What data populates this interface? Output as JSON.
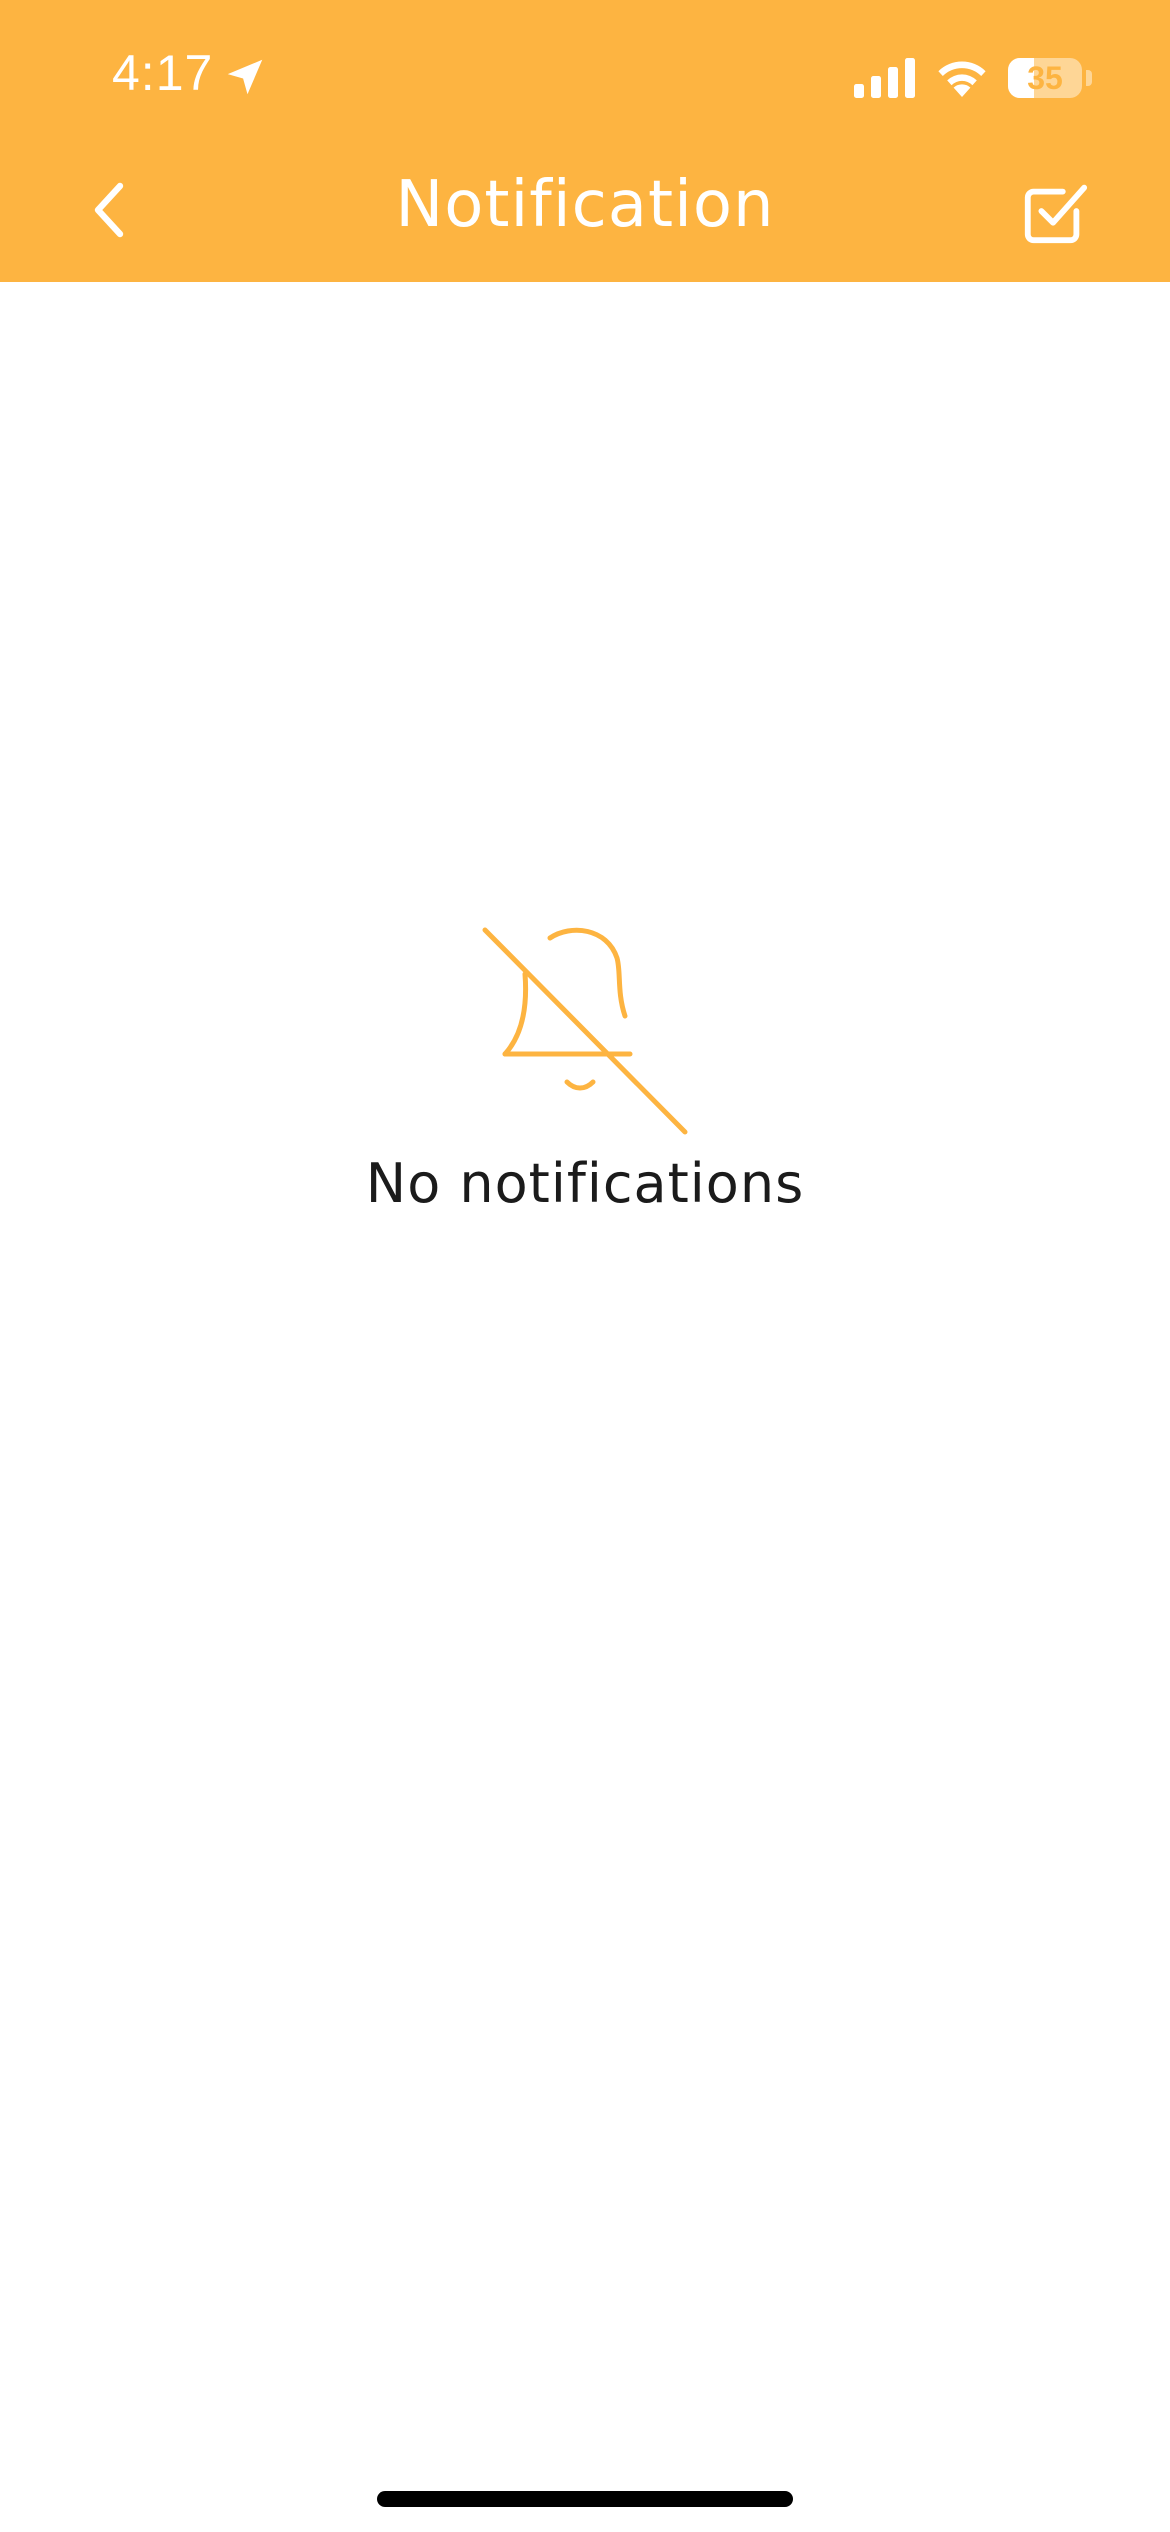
{
  "status_bar": {
    "time": "4:17",
    "battery_level": "35",
    "battery_fraction": 0.35,
    "location_icon": "location-arrow-icon",
    "signal_icon": "cellular-signal-icon",
    "wifi_icon": "wifi-icon"
  },
  "nav": {
    "title": "Notification",
    "back_icon": "chevron-left-icon",
    "action_icon": "checkbox-check-icon"
  },
  "empty_state": {
    "icon": "bell-off-icon",
    "message": "No notifications"
  },
  "colors": {
    "accent": "#FDB441",
    "header_text": "#FFFFFF",
    "body_text": "#1B1B1B",
    "background": "#FFFFFF"
  }
}
